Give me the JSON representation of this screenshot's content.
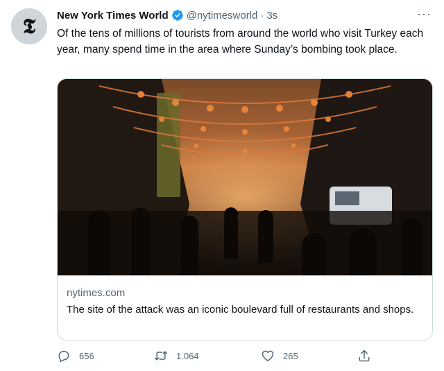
{
  "tweet": {
    "author_name": "New York Times World",
    "handle": "@nytimesworld",
    "separator": "·",
    "time": "3s",
    "more_label": "···",
    "text": "Of the tens of millions of tourists from around the world who visit Turkey each year, many spend time in the area where Sunday’s bombing took place."
  },
  "card": {
    "domain": "nytimes.com",
    "title": "The site of the attack was an iconic boulevard full of restaurants and shops.",
    "image_icon": "street-photo"
  },
  "actions": {
    "reply_count": "656",
    "retweet_count": "1.064",
    "like_count": "265"
  },
  "colors": {
    "text": "#0f1419",
    "secondary": "#536471",
    "verified": "#1d9bf0",
    "border": "#cfd9de"
  },
  "icons": {
    "avatar": "nyt-logo-icon",
    "verified": "verified-badge-icon",
    "reply": "reply-icon",
    "retweet": "retweet-icon",
    "like": "heart-icon",
    "share": "share-icon"
  }
}
